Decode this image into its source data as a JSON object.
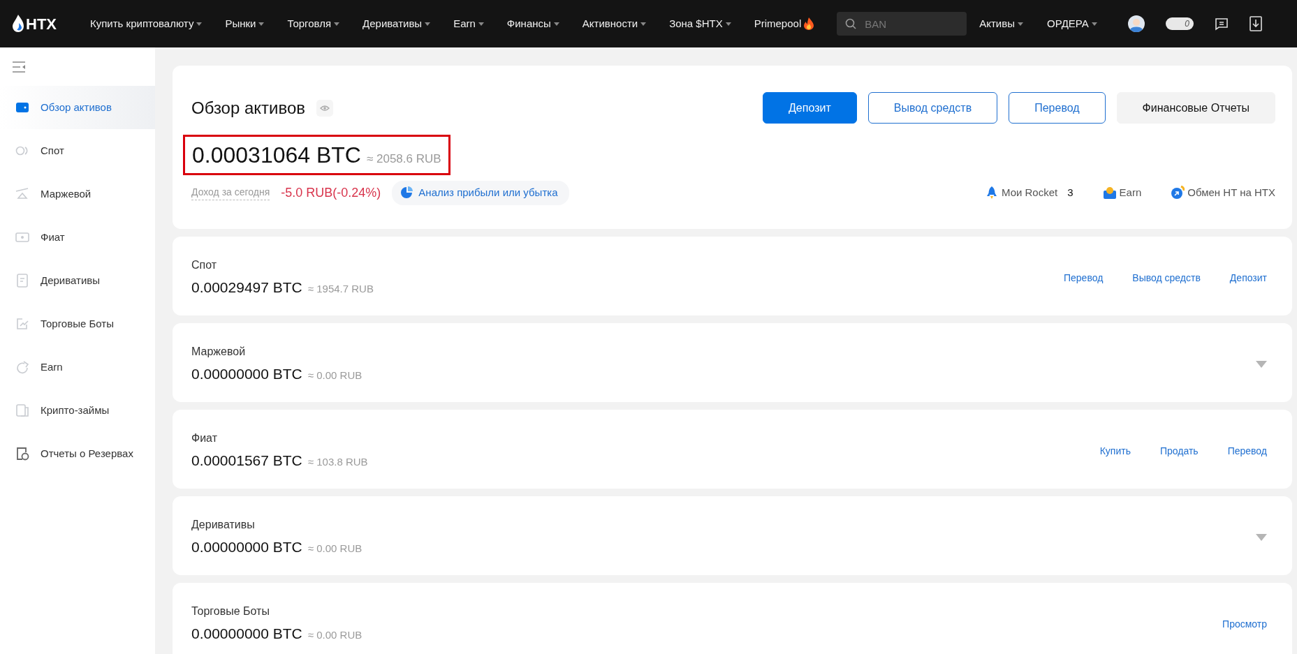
{
  "nav": {
    "logo": "HTX",
    "menu": [
      {
        "label": "Купить криптовалюту",
        "dropdown": true
      },
      {
        "label": "Рынки",
        "dropdown": true
      },
      {
        "label": "Торговля",
        "dropdown": true
      },
      {
        "label": "Деривативы",
        "dropdown": true
      },
      {
        "label": "Earn",
        "dropdown": true
      },
      {
        "label": "Финансы",
        "dropdown": true
      },
      {
        "label": "Активности",
        "dropdown": true
      },
      {
        "label": "Зона $HTX",
        "dropdown": true
      },
      {
        "label": "Primepool",
        "dropdown": false,
        "hot": true
      }
    ],
    "search": {
      "placeholder": "BAN"
    },
    "right_menu": [
      {
        "label": "Активы",
        "dropdown": true
      },
      {
        "label": "ОРДЕРА",
        "dropdown": true
      }
    ],
    "toggle_count": "0",
    "toggle_on": false
  },
  "sidebar": {
    "items": [
      {
        "label": "Обзор активов",
        "kind": "wallet",
        "selected": true
      },
      {
        "label": "Спот",
        "kind": "spot",
        "selected": false
      },
      {
        "label": "Маржевой",
        "kind": "margin",
        "selected": false
      },
      {
        "label": "Фиат",
        "kind": "fiat",
        "selected": false
      },
      {
        "label": "Деривативы",
        "kind": "doc",
        "selected": false
      },
      {
        "label": "Торговые Боты",
        "kind": "bot",
        "selected": false
      },
      {
        "label": "Earn",
        "kind": "earn",
        "selected": false
      },
      {
        "label": "Крипто-займы",
        "kind": "loan",
        "selected": false
      },
      {
        "label": "Отчеты о Резервах",
        "kind": "reserve",
        "selected": false
      }
    ]
  },
  "overview": {
    "title": "Обзор активов",
    "buttons": [
      {
        "label": "Депозит",
        "kind": "primary"
      },
      {
        "label": "Вывод средств",
        "kind": "outline"
      },
      {
        "label": "Перевод",
        "kind": "outline"
      },
      {
        "label": "Финансовые Отчеты",
        "kind": "secondary"
      }
    ],
    "total": "0.00031064 BTC",
    "total_approx": "≈ 2058.6 RUB",
    "highlighted": true,
    "income_label": "Доход за сегодня",
    "income_value": "-5.0 RUB(-0.24%)",
    "pnl_link": "Анализ прибыли или убытка",
    "quick_links": [
      {
        "label": "Мои Rocket",
        "kind": "rocket",
        "count": "3"
      },
      {
        "label": "Earn",
        "kind": "earn"
      },
      {
        "label": "Обмен HT на HTX",
        "kind": "swap"
      }
    ]
  },
  "accounts": [
    {
      "title": "Спот",
      "amount": "0.00029497 BTC",
      "approx": "≈ 1954.7 RUB",
      "actions": [
        "Перевод",
        "Вывод средств",
        "Депозит"
      ],
      "expandable": false
    },
    {
      "title": "Маржевой",
      "amount": "0.00000000 BTC",
      "approx": "≈ 0.00 RUB",
      "expandable": true
    },
    {
      "title": "Фиат",
      "amount": "0.00001567 BTC",
      "approx": "≈ 103.8 RUB",
      "actions": [
        "Купить",
        "Продать",
        "Перевод"
      ],
      "expandable": false
    },
    {
      "title": "Деривативы",
      "amount": "0.00000000 BTC",
      "approx": "≈ 0.00 RUB",
      "expandable": true
    },
    {
      "title": "Торговые Боты",
      "amount": "0.00000000 BTC",
      "approx": "≈ 0.00 RUB",
      "actions": [
        "Просмотр"
      ],
      "expandable": false
    }
  ]
}
